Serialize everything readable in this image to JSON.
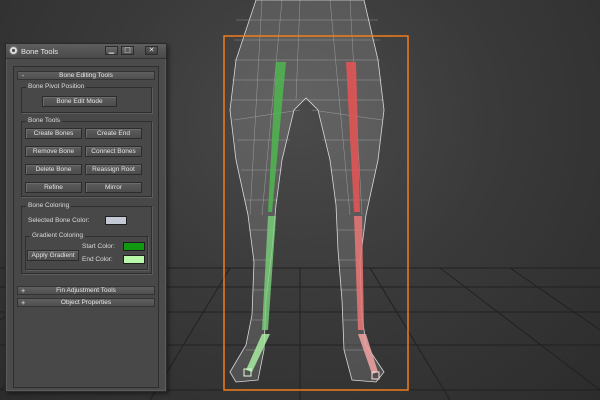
{
  "window": {
    "title": "Bone Tools",
    "minimize_glyph": "▁",
    "maximize_glyph": "□",
    "close_glyph": "✕"
  },
  "rollouts": {
    "bone_editing": {
      "sign": "-",
      "label": "Bone Editing Tools"
    },
    "fin_adjustment": {
      "sign": "+",
      "label": "Fin Adjustment Tools"
    },
    "object_properties": {
      "sign": "+",
      "label": "Object Properties"
    }
  },
  "bone_pivot": {
    "group_label": "Bone Pivot Position",
    "edit_mode": "Bone Edit Mode"
  },
  "bone_tools": {
    "group_label": "Bone Tools",
    "create_bones": "Create Bones",
    "create_end": "Create End",
    "remove_bone": "Remove Bone",
    "connect_bones": "Connect Bones",
    "delete_bone": "Delete Bone",
    "reassign_root": "Reassign Root",
    "refine": "Refine",
    "mirror": "Mirror"
  },
  "bone_coloring": {
    "group_label": "Bone Coloring",
    "selected_label": "Selected Bone Color:",
    "selected_color": "#c3cad6",
    "gradient": {
      "group_label": "Gradient Coloring",
      "apply": "Apply Gradient",
      "start_label": "Start Color:",
      "start_color": "#119a11",
      "end_label": "End Color:",
      "end_color": "#b9f7ab"
    }
  },
  "scene": {
    "selection_color": "#f07c1e",
    "left_leg_bone_color": "#5fb95f",
    "right_leg_bone_color": "#e06464"
  }
}
